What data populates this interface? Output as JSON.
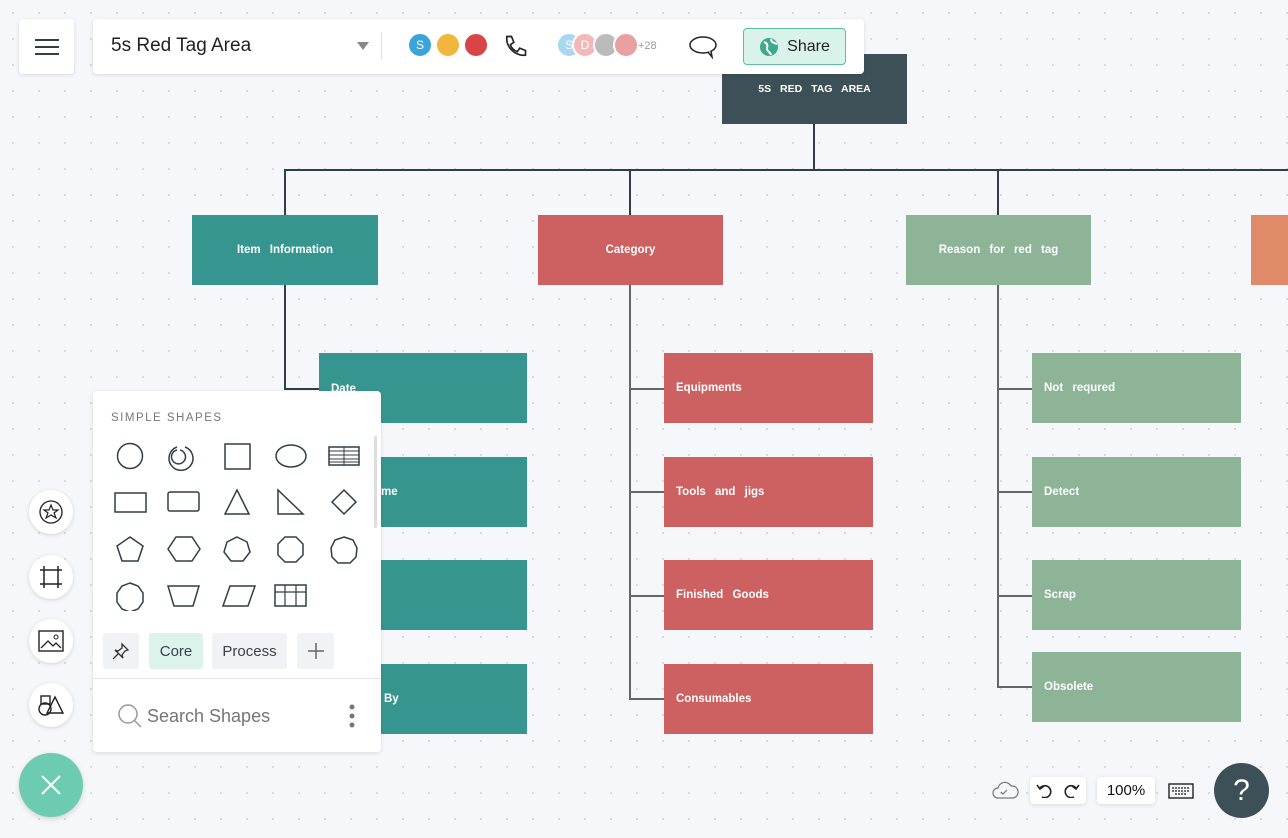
{
  "header": {
    "title": "5s Red Tag Area",
    "collab_count": "+28",
    "share_label": "Share",
    "avatar_initials": [
      "S",
      "S",
      "D"
    ]
  },
  "colors": {
    "root": "#3d5057",
    "teal": "#36968f",
    "red": "#cd6060",
    "green": "#8db497",
    "orange": "#e08a6a",
    "fab": "#6ccbb0"
  },
  "diagram": {
    "root": "5S RED TAG AREA",
    "branches": [
      {
        "label": "Item Information",
        "children": [
          "Date",
          "me",
          "",
          "By"
        ]
      },
      {
        "label": "Category",
        "children": [
          "Equipments",
          "Tools and jigs",
          "Finished Goods",
          "Consumables"
        ]
      },
      {
        "label": "Reason for red tag",
        "children": [
          "Not requred",
          "Detect",
          "Scrap",
          "Obsolete"
        ]
      }
    ]
  },
  "shapes_panel": {
    "section_title": "SIMPLE SHAPES",
    "tabs": [
      "Core",
      "Process"
    ],
    "search_placeholder": "Search Shapes"
  },
  "bottom_bar": {
    "zoom": "100%",
    "help": "?"
  }
}
